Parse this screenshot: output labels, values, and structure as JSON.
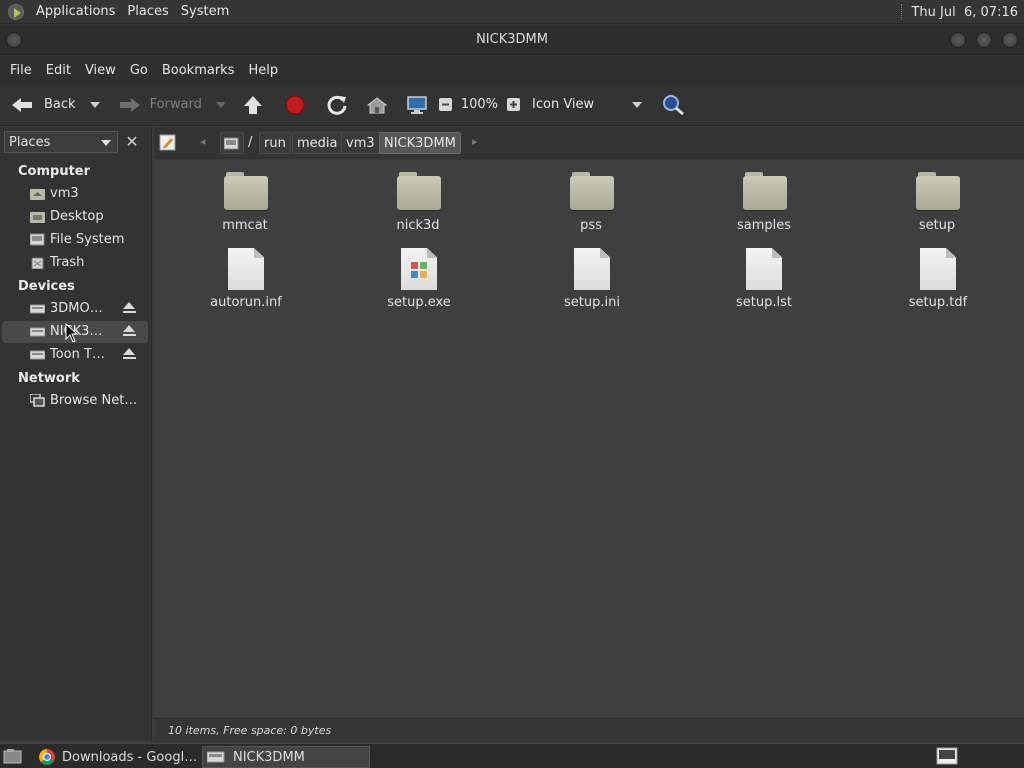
{
  "top_panel": {
    "menus": [
      "Applications",
      "Places",
      "System"
    ],
    "clock": "Thu Jul  6, 07:16"
  },
  "window": {
    "title": "NICK3DMM"
  },
  "menubar": [
    "File",
    "Edit",
    "View",
    "Go",
    "Bookmarks",
    "Help"
  ],
  "toolbar": {
    "back_label": "Back",
    "forward_label": "Forward",
    "zoom": "100%",
    "view_mode": "Icon View"
  },
  "sidebar": {
    "combo_label": "Places",
    "sections": {
      "computer": "Computer",
      "devices": "Devices",
      "network": "Network"
    },
    "computer_items": [
      "vm3",
      "Desktop",
      "File System",
      "Trash"
    ],
    "device_items": [
      "3DMO…",
      "NICK3…",
      "Toon T…"
    ],
    "network_items": [
      "Browse Net…"
    ]
  },
  "pathbar": {
    "sep": "/",
    "crumbs": [
      "run",
      "media",
      "vm3",
      "NICK3DMM"
    ]
  },
  "files": [
    {
      "name": "mmcat",
      "kind": "folder"
    },
    {
      "name": "nick3d",
      "kind": "folder"
    },
    {
      "name": "pss",
      "kind": "folder"
    },
    {
      "name": "samples",
      "kind": "folder"
    },
    {
      "name": "setup",
      "kind": "folder"
    },
    {
      "name": "autorun.inf",
      "kind": "file"
    },
    {
      "name": "setup.exe",
      "kind": "exe"
    },
    {
      "name": "setup.ini",
      "kind": "file"
    },
    {
      "name": "setup.lst",
      "kind": "file"
    },
    {
      "name": "setup.tdf",
      "kind": "file"
    }
  ],
  "status": "10 items, Free space: 0 bytes",
  "taskbar": {
    "tasks": [
      "Downloads - Googl…",
      "NICK3DMM"
    ]
  },
  "colors": {
    "folder": "#b8baa6",
    "stop_red": "#c21d1d",
    "accent_green": "#a8c94c"
  }
}
